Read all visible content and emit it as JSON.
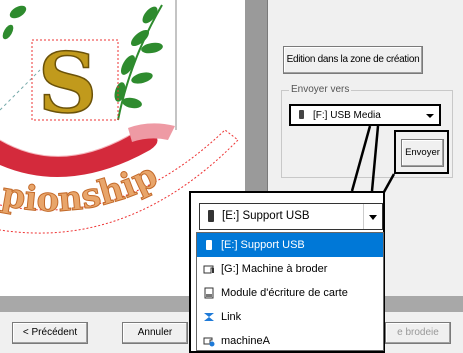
{
  "canvas": {
    "letter": "S",
    "arc_text": "pionship"
  },
  "panel": {
    "edit_button": "Edition dans la zone de création",
    "send_group_label": "Envoyer vers",
    "send_select_value": "[F:] USB Media",
    "send_button": "Envoyer"
  },
  "footer": {
    "prev_button": "< Précédent",
    "cancel_button": "Annuler",
    "embroidery_button": "e brodeie"
  },
  "callout": {
    "select_value": "[E:] Support USB",
    "options": [
      {
        "label": "[E:] Support USB",
        "icon": "usb-drive-icon",
        "selected": true
      },
      {
        "label": "[G:] Machine à broder",
        "icon": "embroidery-machine-icon",
        "selected": false
      },
      {
        "label": "Module d'écriture de carte",
        "icon": "card-writer-icon",
        "selected": false
      },
      {
        "label": "Link",
        "icon": "link-icon",
        "selected": false
      },
      {
        "label": "machineA",
        "icon": "network-machine-icon",
        "selected": false
      }
    ]
  },
  "colors": {
    "gold": "#c19a1c",
    "green": "#2e8b2e",
    "red": "#d42a3c",
    "selection": "#0078d7"
  }
}
